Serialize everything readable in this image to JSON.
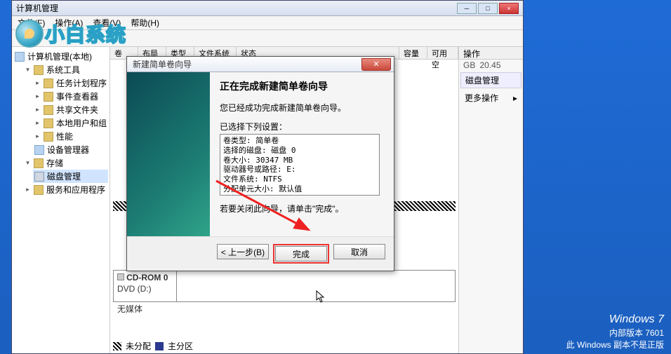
{
  "logo_text": "小白系统",
  "mgr": {
    "title": "计算机管理",
    "menu": {
      "file": "文件(F)",
      "action": "操作(A)",
      "view": "查看(V)",
      "help": "帮助(H)"
    },
    "winbtn_min": "─",
    "winbtn_max": "□",
    "winbtn_close": "×"
  },
  "tree": {
    "root": "计算机管理(本地)",
    "systools": "系统工具",
    "task": "任务计划程序",
    "event": "事件查看器",
    "shared": "共享文件夹",
    "users": "本地用户和组",
    "perf": "性能",
    "devmgr": "设备管理器",
    "storage": "存储",
    "diskmgmt": "磁盘管理",
    "services": "服务和应用程序"
  },
  "cols": {
    "vol": "卷",
    "layout": "布局",
    "type": "类型",
    "fs": "文件系统",
    "status": "状态",
    "cap": "容量",
    "free": "可用空",
    "ops": "操作"
  },
  "right": {
    "header": "磁盘管理",
    "more": "更多操作",
    "gb": "GB",
    "gbval": "20.45"
  },
  "cdrom": {
    "label": "CD-ROM 0",
    "letter": "DVD (D:)",
    "nomedia": "无媒体"
  },
  "legend": {
    "unalloc": "未分配",
    "primary": "主分区"
  },
  "dialog": {
    "title": "新建简单卷向导",
    "heading": "正在完成新建简单卷向导",
    "done_msg": "您已经成功完成新建简单卷向导。",
    "selected": "已选择下列设置：",
    "list": "卷类型: 简单卷\n选择的磁盘: 磁盘 0\n卷大小: 30347 MB\n驱动器号或路径: E:\n文件系统: NTFS\n分配单元大小: 默认值\n卷标: 新加卷\n快速格式化: 是",
    "close_hint": "若要关闭此向导，请单击\"完成\"。",
    "back": "< 上一步(B)",
    "finish": "完成",
    "cancel": "取消"
  },
  "footer": {
    "brand": "Windows 7",
    "build": "内部版本 7601",
    "notgenuine": "此 Windows 副本不是正版"
  }
}
